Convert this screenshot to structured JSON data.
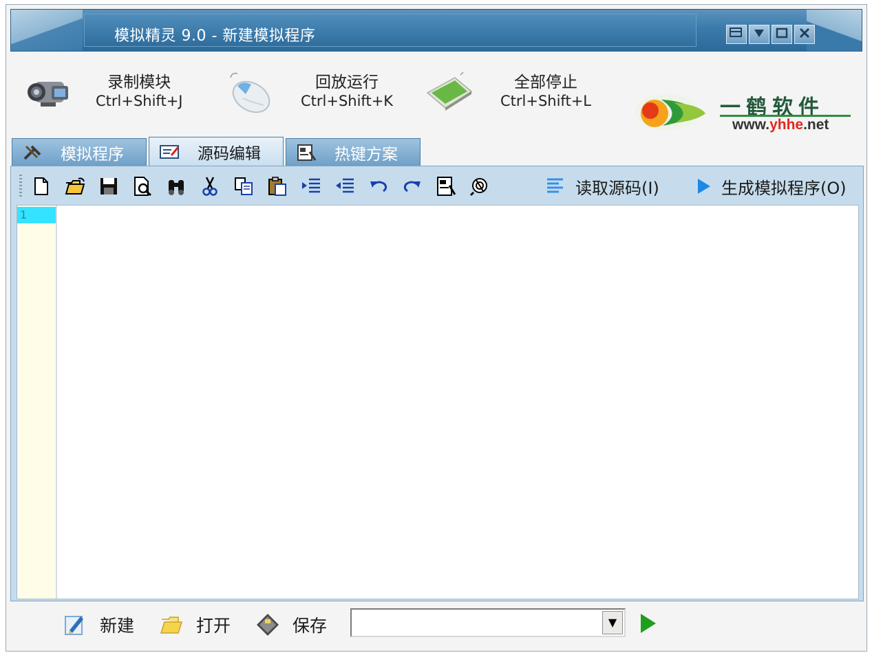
{
  "window": {
    "title": "模拟精灵 9.0 - 新建模拟程序",
    "controls": [
      "restore-down-icon",
      "minimize-icon",
      "maximize-icon",
      "close-icon"
    ]
  },
  "big_toolbar": {
    "record": {
      "label": "录制模块",
      "shortcut": "Ctrl+Shift+J",
      "icon": "camcorder-icon"
    },
    "playback": {
      "label": "回放运行",
      "shortcut": "Ctrl+Shift+K",
      "icon": "mouse-icon"
    },
    "stop_all": {
      "label": "全部停止",
      "shortcut": "Ctrl+Shift+L",
      "icon": "green-pad-icon"
    }
  },
  "logo": {
    "cn": "一鹤软件",
    "url_prefix": "www.",
    "url_mid": "yhhe",
    "url_suffix": ".net"
  },
  "tabs": [
    {
      "label": "模拟程序",
      "icon": "tools-icon",
      "active": false
    },
    {
      "label": "源码编辑",
      "icon": "edit-icon",
      "active": true
    },
    {
      "label": "热键方案",
      "icon": "hotkey-icon",
      "active": false
    }
  ],
  "code_toolbar": {
    "icons": [
      "new-file-icon",
      "open-folder-icon",
      "save-icon",
      "print-preview-icon",
      "find-icon",
      "cut-icon",
      "copy-icon",
      "paste-icon",
      "indent-icon",
      "outdent-icon",
      "undo-icon",
      "redo-icon",
      "script-icon",
      "debug-icon"
    ],
    "read_source_label": "读取源码(I)",
    "generate_label": "生成模拟程序(O)"
  },
  "editor": {
    "line_number": "1"
  },
  "bottom_bar": {
    "new_label": "新建",
    "open_label": "打开",
    "save_label": "保存",
    "combo_value": ""
  },
  "colors": {
    "title_bar": "#3a7aab",
    "tab_active": "#d9e8f4",
    "gutter": "#fffde8",
    "line_highlight": "#34e3ff",
    "play_green": "#1e9e1e"
  }
}
